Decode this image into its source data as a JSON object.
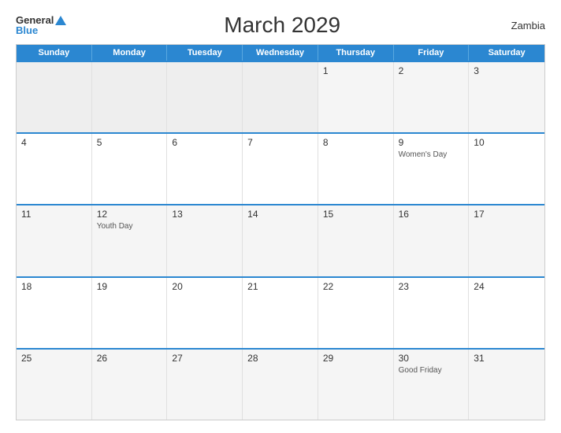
{
  "header": {
    "logo_general": "General",
    "logo_blue": "Blue",
    "title": "March 2029",
    "country": "Zambia"
  },
  "calendar": {
    "days_of_week": [
      "Sunday",
      "Monday",
      "Tuesday",
      "Wednesday",
      "Thursday",
      "Friday",
      "Saturday"
    ],
    "rows": [
      [
        {
          "num": "",
          "holiday": "",
          "empty": true
        },
        {
          "num": "",
          "holiday": "",
          "empty": true
        },
        {
          "num": "",
          "holiday": "",
          "empty": true
        },
        {
          "num": "",
          "holiday": "",
          "empty": true
        },
        {
          "num": "1",
          "holiday": "",
          "empty": false
        },
        {
          "num": "2",
          "holiday": "",
          "empty": false
        },
        {
          "num": "3",
          "holiday": "",
          "empty": false
        }
      ],
      [
        {
          "num": "4",
          "holiday": "",
          "empty": false
        },
        {
          "num": "5",
          "holiday": "",
          "empty": false
        },
        {
          "num": "6",
          "holiday": "",
          "empty": false
        },
        {
          "num": "7",
          "holiday": "",
          "empty": false
        },
        {
          "num": "8",
          "holiday": "",
          "empty": false
        },
        {
          "num": "9",
          "holiday": "Women's Day",
          "empty": false
        },
        {
          "num": "10",
          "holiday": "",
          "empty": false
        }
      ],
      [
        {
          "num": "11",
          "holiday": "",
          "empty": false
        },
        {
          "num": "12",
          "holiday": "Youth Day",
          "empty": false
        },
        {
          "num": "13",
          "holiday": "",
          "empty": false
        },
        {
          "num": "14",
          "holiday": "",
          "empty": false
        },
        {
          "num": "15",
          "holiday": "",
          "empty": false
        },
        {
          "num": "16",
          "holiday": "",
          "empty": false
        },
        {
          "num": "17",
          "holiday": "",
          "empty": false
        }
      ],
      [
        {
          "num": "18",
          "holiday": "",
          "empty": false
        },
        {
          "num": "19",
          "holiday": "",
          "empty": false
        },
        {
          "num": "20",
          "holiday": "",
          "empty": false
        },
        {
          "num": "21",
          "holiday": "",
          "empty": false
        },
        {
          "num": "22",
          "holiday": "",
          "empty": false
        },
        {
          "num": "23",
          "holiday": "",
          "empty": false
        },
        {
          "num": "24",
          "holiday": "",
          "empty": false
        }
      ],
      [
        {
          "num": "25",
          "holiday": "",
          "empty": false
        },
        {
          "num": "26",
          "holiday": "",
          "empty": false
        },
        {
          "num": "27",
          "holiday": "",
          "empty": false
        },
        {
          "num": "28",
          "holiday": "",
          "empty": false
        },
        {
          "num": "29",
          "holiday": "",
          "empty": false
        },
        {
          "num": "30",
          "holiday": "Good Friday",
          "empty": false
        },
        {
          "num": "31",
          "holiday": "",
          "empty": false
        }
      ]
    ]
  }
}
